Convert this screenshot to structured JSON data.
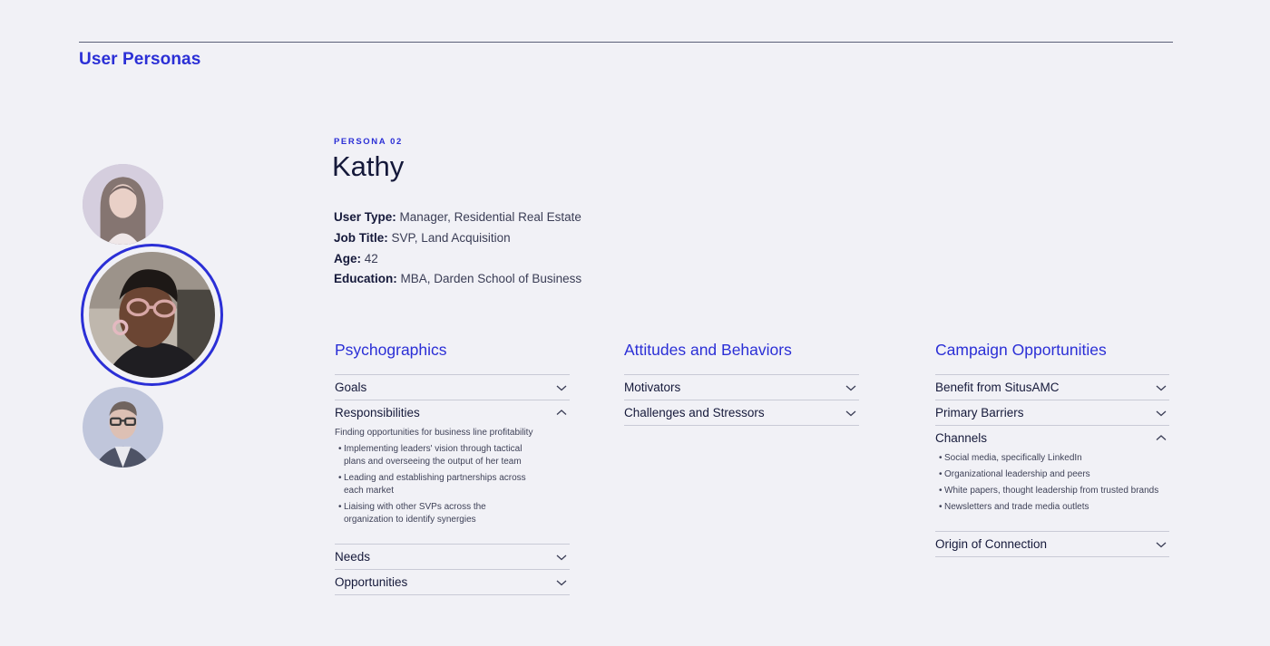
{
  "page": {
    "title": "User Personas"
  },
  "personas": {
    "avatars": [
      {
        "name": "persona-01-avatar"
      },
      {
        "name": "persona-02-avatar",
        "selected": true
      },
      {
        "name": "persona-03-avatar"
      }
    ]
  },
  "persona": {
    "eyebrow": "PERSONA 02",
    "name": "Kathy",
    "details": [
      {
        "label": "User Type:",
        "value": "Manager, Residential Real Estate"
      },
      {
        "label": "Job Title:",
        "value": "SVP, Land Acquisition"
      },
      {
        "label": "Age:",
        "value": "42"
      },
      {
        "label": "Education:",
        "value": "MBA, Darden School of Business"
      }
    ]
  },
  "psychographics": {
    "heading": "Psychographics",
    "goals": "Goals",
    "responsibilities": "Responsibilities",
    "responsibilities_lead": "Finding opportunities for business line profitability",
    "responsibilities_items": [
      "Implementing leaders' vision through tactical plans and overseeing the output of her team",
      "Leading and establishing partnerships across each market",
      "Liaising with other SVPs across the organization to identify synergies"
    ],
    "needs": "Needs",
    "opportunities": "Opportunities"
  },
  "attitudes": {
    "heading": "Attitudes and Behaviors",
    "motivators": "Motivators",
    "challenges": "Challenges and Stressors"
  },
  "campaign": {
    "heading": "Campaign Opportunities",
    "benefit": "Benefit from SitusAMC",
    "barriers": "Primary Barriers",
    "channels": "Channels",
    "channels_items": [
      "Social media, specifically LinkedIn",
      "Organizational leadership and peers",
      "White papers, thought leadership from trusted brands",
      "Newsletters and trade media outlets"
    ],
    "origin": "Origin of Connection"
  },
  "colors": {
    "accent": "#2b2fd6",
    "background": "#f1f1f6",
    "text": "#15193a",
    "divider": "#c9cad6"
  },
  "icons": {
    "collapsed": "chevron-down-icon",
    "expanded": "chevron-up-icon"
  }
}
